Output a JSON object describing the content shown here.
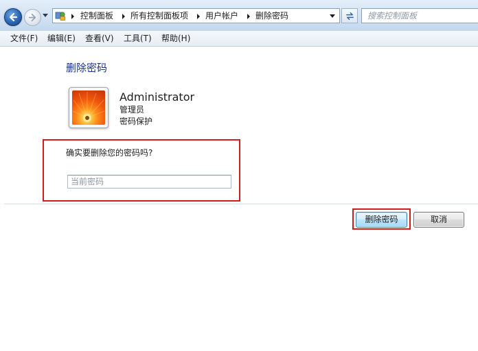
{
  "nav": {
    "breadcrumbs": [
      "控制面板",
      "所有控制面板项",
      "用户帐户",
      "删除密码"
    ],
    "search_placeholder": "搜索控制面板"
  },
  "menu": {
    "items": [
      "文件(F)",
      "编辑(E)",
      "查看(V)",
      "工具(T)",
      "帮助(H)"
    ]
  },
  "page": {
    "title": "删除密码",
    "user_name": "Administrator",
    "user_role": "管理员",
    "user_status": "密码保护",
    "confirm_question": "确实要删除您的密码吗?",
    "password_placeholder": "当前密码"
  },
  "buttons": {
    "delete_label": "删除密码",
    "cancel_label": "取消"
  },
  "colors": {
    "highlight_border": "#d01c1c",
    "title_blue": "#1e3287"
  }
}
